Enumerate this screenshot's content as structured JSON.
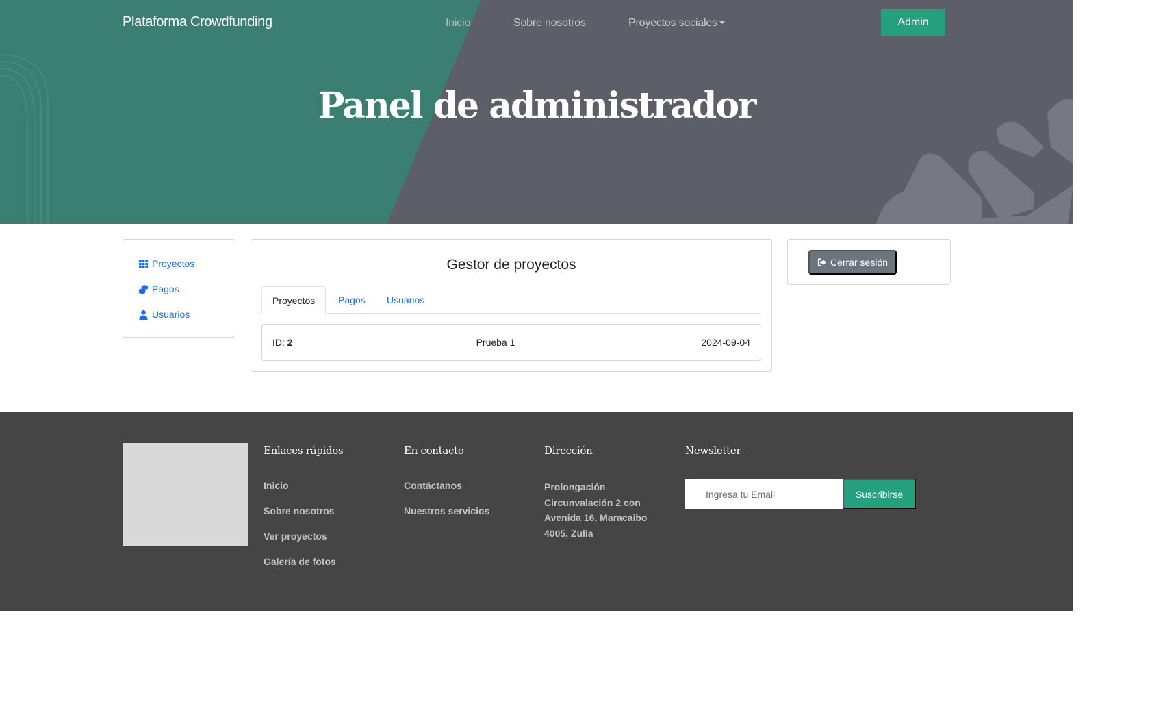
{
  "nav": {
    "brand": "Plataforma Crowdfunding",
    "links": [
      "Inicio",
      "Sobre nosotros",
      "Proyectos sociales"
    ],
    "admin_label": "Admin"
  },
  "hero": {
    "title": "Panel de administrador"
  },
  "sidebar": {
    "items": [
      {
        "label": "Proyectos",
        "icon": "grid-icon"
      },
      {
        "label": "Pagos",
        "icon": "coins-icon"
      },
      {
        "label": "Usuarios",
        "icon": "user-icon"
      }
    ]
  },
  "manager": {
    "title": "Gestor de proyectos",
    "tabs": [
      "Proyectos",
      "Pagos",
      "Usuarios"
    ],
    "active_tab": "Proyectos",
    "rows": [
      {
        "id_label": "ID:",
        "id": "2",
        "name": "Prueba 1",
        "date": "2024-09-04"
      }
    ]
  },
  "session": {
    "logout_label": "Cerrar sesión"
  },
  "footer": {
    "quick_links_title": "Enlaces rápidos",
    "quick_links": [
      "Inicio",
      "Sobre nosotros",
      "Ver proyectos",
      "Galería de fotos"
    ],
    "contact_title": "En contacto",
    "contact_links": [
      "Contáctanos",
      "Nuestros servicios"
    ],
    "address_title": "Dirección",
    "address": "Prolongación Circunvalación 2 con Avenida 16, Maracaibo 4005, Zulia",
    "newsletter_title": "Newsletter",
    "newsletter_placeholder": "Ingresa tu Email",
    "newsletter_button": "Suscribirse"
  },
  "colors": {
    "hero_green": "#3b7f72",
    "hero_gray": "#5d5f68",
    "accent": "#24a07f",
    "link_blue": "#1a6fe6",
    "footer_bg": "#454545"
  }
}
